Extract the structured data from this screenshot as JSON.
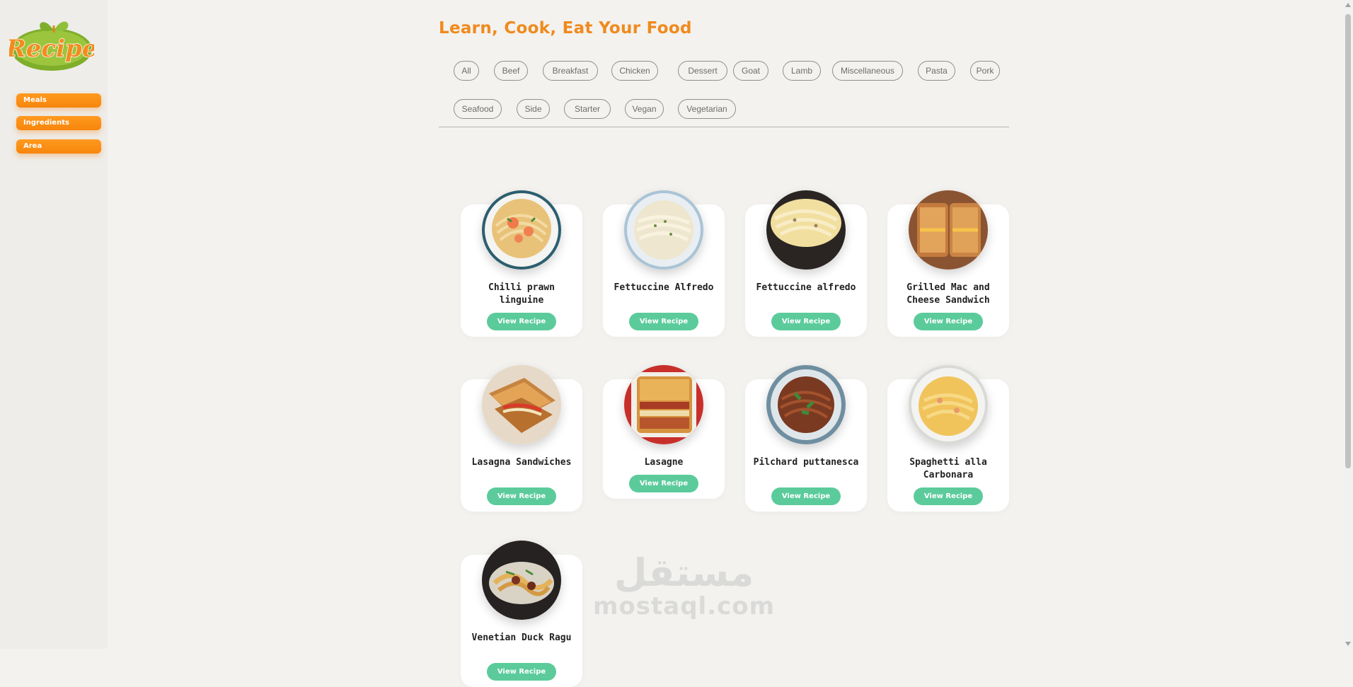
{
  "logo": {
    "text": "Recipe"
  },
  "sidebar": {
    "items": [
      {
        "label": "Meals"
      },
      {
        "label": "Ingredients"
      },
      {
        "label": "Area"
      }
    ]
  },
  "page_title": "Learn, Cook, Eat Your Food",
  "categories": [
    "All",
    "Beef",
    "Breakfast",
    "Chicken",
    "Dessert",
    "Goat",
    "Lamb",
    "Miscellaneous",
    "Pasta",
    "Pork",
    "Seafood",
    "Side",
    "Starter",
    "Vegan",
    "Vegetarian"
  ],
  "meals": [
    {
      "name": "Chilli prawn linguine",
      "button": "View Recipe"
    },
    {
      "name": "Fettuccine Alfredo",
      "button": "View Recipe"
    },
    {
      "name": "Fettuccine alfredo",
      "button": "View Recipe"
    },
    {
      "name": "Grilled Mac and Cheese Sandwich",
      "button": "View Recipe"
    },
    {
      "name": "Lasagna Sandwiches",
      "button": "View Recipe"
    },
    {
      "name": "Lasagne",
      "button": "View Recipe"
    },
    {
      "name": "Pilchard puttanesca",
      "button": "View Recipe"
    },
    {
      "name": "Spaghetti alla Carbonara",
      "button": "View Recipe"
    },
    {
      "name": "Venetian Duck Ragu",
      "button": "View Recipe"
    }
  ],
  "watermark": {
    "arabic": "مستقل",
    "latin": "mostaql.com"
  },
  "colors": {
    "accent": "#f7850c",
    "title": "#f08a1d",
    "button": "#5bcb9b",
    "background": "#f3f2ef"
  }
}
